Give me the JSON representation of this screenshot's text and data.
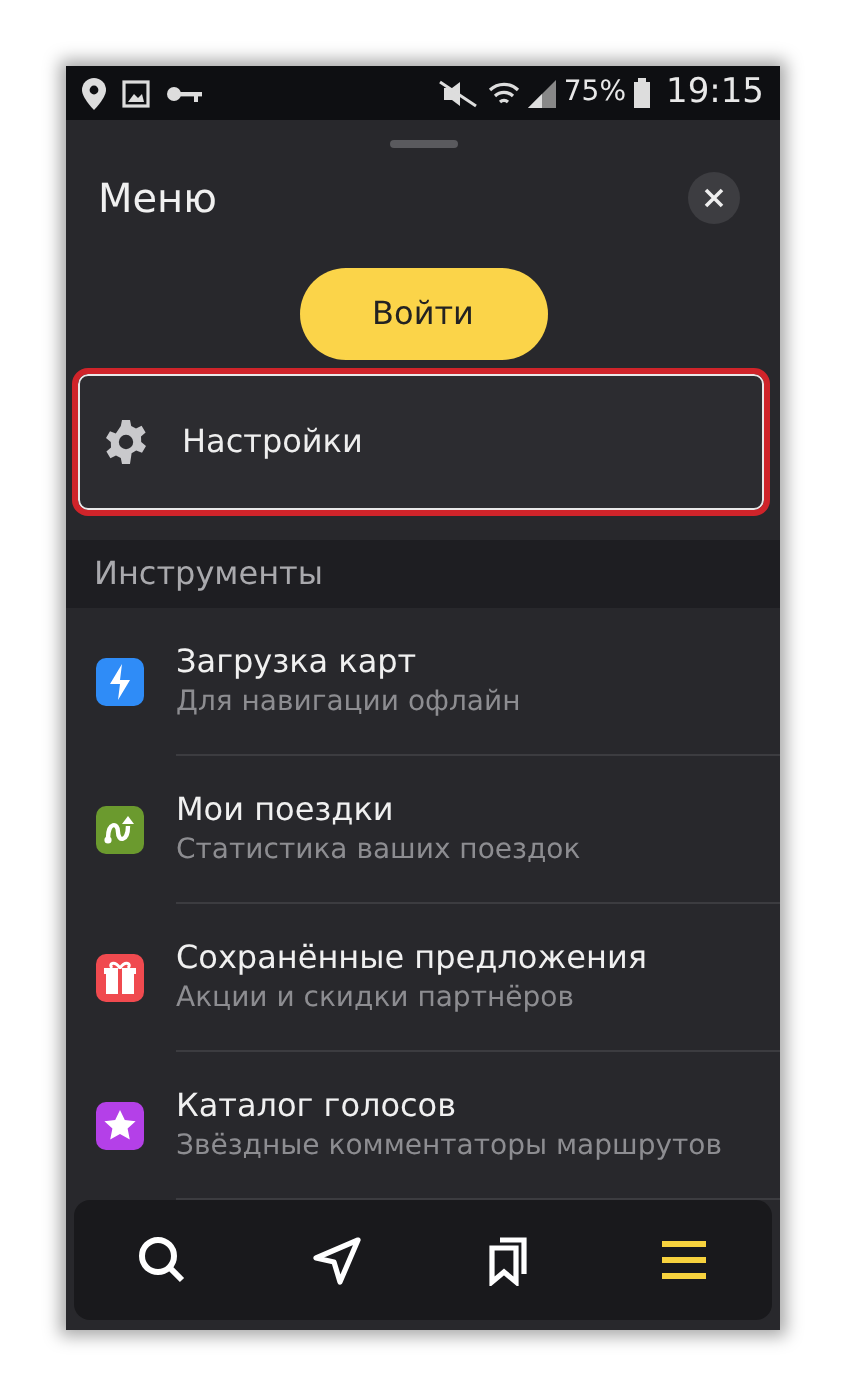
{
  "status_bar": {
    "battery": "75%",
    "time": "19:15"
  },
  "menu": {
    "title": "Меню",
    "login_button": "Войти",
    "settings": {
      "label": "Настройки",
      "highlighted": true
    },
    "section": "Инструменты",
    "items": [
      {
        "kind": "download",
        "title": "Загрузка карт",
        "subtitle": "Для навигации офлайн",
        "color": "#2f8cf7"
      },
      {
        "kind": "trips",
        "title": "Мои поездки",
        "subtitle": "Статистика ваших поездок",
        "color": "#6b9a2e"
      },
      {
        "kind": "offers",
        "title": "Сохранённые предложения",
        "subtitle": "Акции и скидки партнёров",
        "color": "#f04a4f"
      },
      {
        "kind": "voices",
        "title": "Каталог голосов",
        "subtitle": "Звёздные комментаторы маршрутов",
        "color": "#b440e8"
      }
    ]
  },
  "bottom_nav": [
    {
      "kind": "search",
      "selected": false
    },
    {
      "kind": "route",
      "selected": false
    },
    {
      "kind": "bookmarks",
      "selected": false
    },
    {
      "kind": "menu",
      "selected": true
    }
  ]
}
